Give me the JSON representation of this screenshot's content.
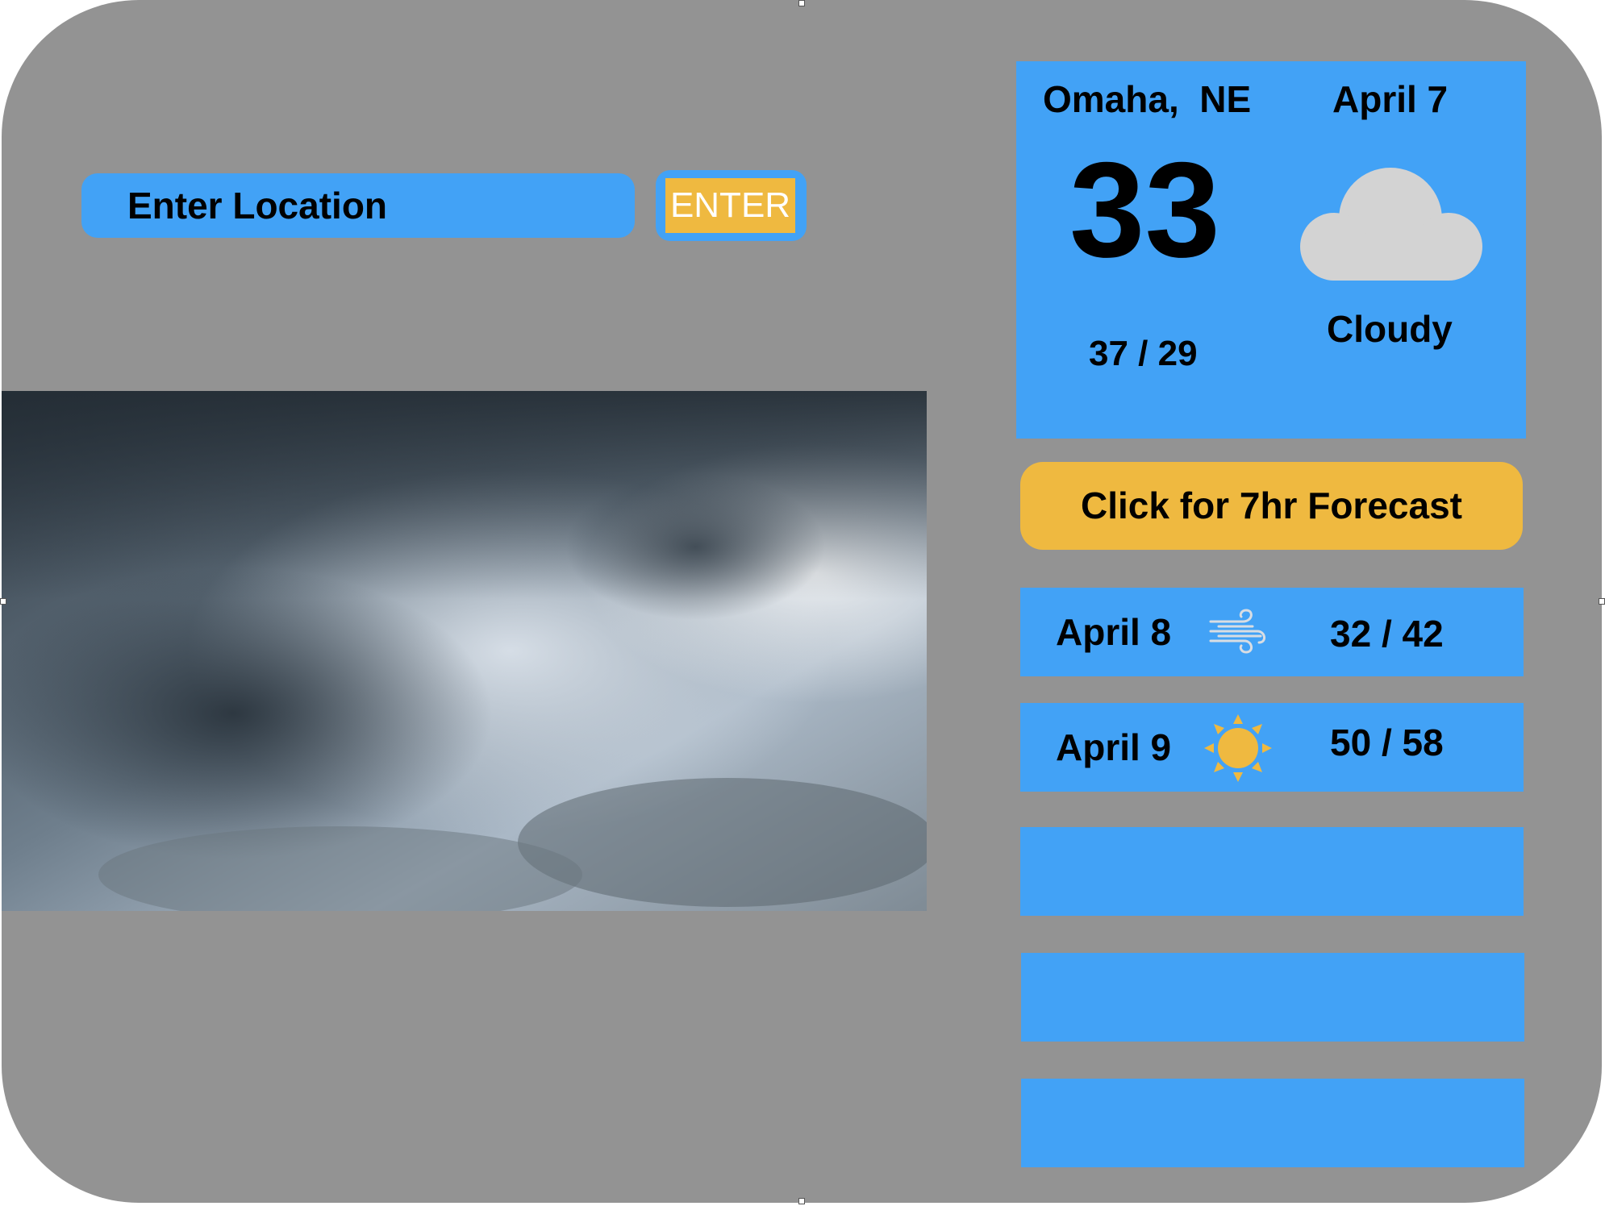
{
  "search": {
    "placeholder": "Enter Location",
    "button_label": "ENTER"
  },
  "current": {
    "location": "Omaha,  NE",
    "date": "April 7",
    "temperature": "33",
    "hi_lo": "37 / 29",
    "condition": "Cloudy",
    "icon": "cloud-icon"
  },
  "forecast_button": {
    "label": "Click for 7hr Forecast"
  },
  "daily": [
    {
      "date": "April 8",
      "icon": "wind-icon",
      "temps": "32 / 42"
    },
    {
      "date": "April 9",
      "icon": "sun-icon",
      "temps": "50 / 58"
    },
    {
      "date": "",
      "icon": "",
      "temps": ""
    },
    {
      "date": "",
      "icon": "",
      "temps": ""
    },
    {
      "date": "",
      "icon": "",
      "temps": ""
    }
  ],
  "colors": {
    "background": "#939393",
    "panel_blue": "#42a2f6",
    "accent_yellow": "#efb940",
    "cloud_gray": "#d3d3d3"
  }
}
